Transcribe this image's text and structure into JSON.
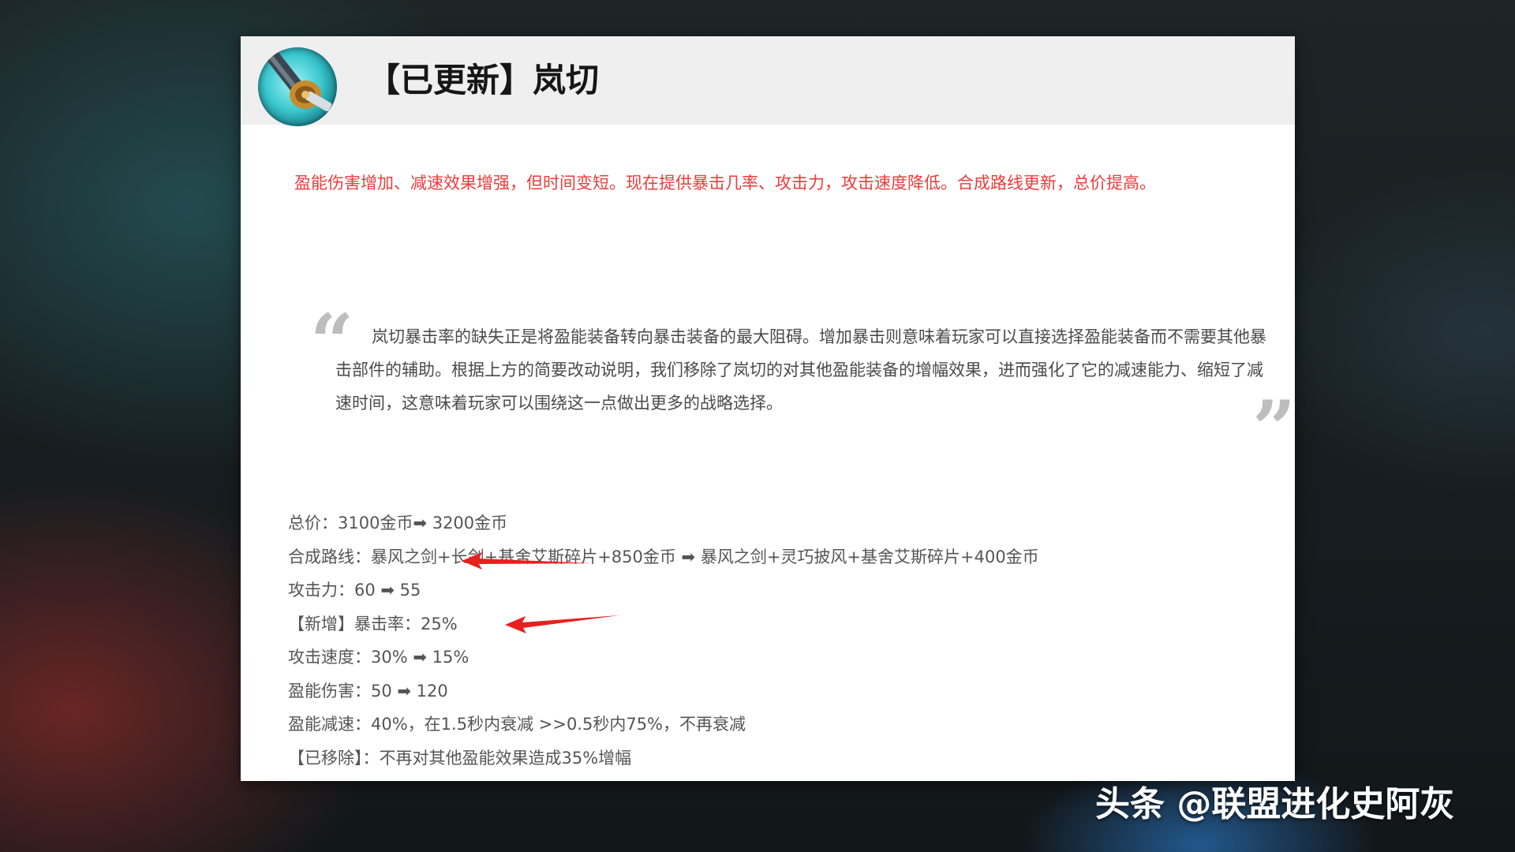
{
  "header": {
    "title": "【已更新】岚切",
    "icon": "stormrazor-item-icon"
  },
  "summary": "盈能伤害增加、减速效果增强，但时间变短。现在提供暴击几率、攻击力，攻击速度降低。合成路线更新，总价提高。",
  "quote": {
    "open_mark": "“",
    "close_mark": "”",
    "text": "岚切暴击率的缺失正是将盈能装备转向暴击装备的最大阻碍。增加暴击则意味着玩家可以直接选择盈能装备而不需要其他暴击部件的辅助。根据上方的简要改动说明，我们移除了岚切的对其他盈能装备的增幅效果，进而强化了它的减速能力、缩短了减速时间，这意味着玩家可以围绕这一点做出更多的战略选择。"
  },
  "stats": [
    "总价：3100金币➡ 3200金币",
    "合成路线：暴风之剑+长剑+基舍艾斯碎片+850金币 ➡ 暴风之剑+灵巧披风+基舍艾斯碎片+400金币",
    "攻击力：60 ➡ 55",
    "【新增】暴击率：25%",
    "攻击速度：30% ➡ 15%",
    "盈能伤害：50 ➡ 120",
    "盈能减速：40%，在1.5秒内衰减 >>0.5秒内75%，不再衰减",
    "【已移除】：不再对其他盈能效果造成35%增幅"
  ],
  "watermark": "头条 @联盟进化史阿灰",
  "colors": {
    "summary_red": "#ee3b3b",
    "annotation_arrow_red": "#e8201e",
    "header_bg": "#efefef"
  }
}
